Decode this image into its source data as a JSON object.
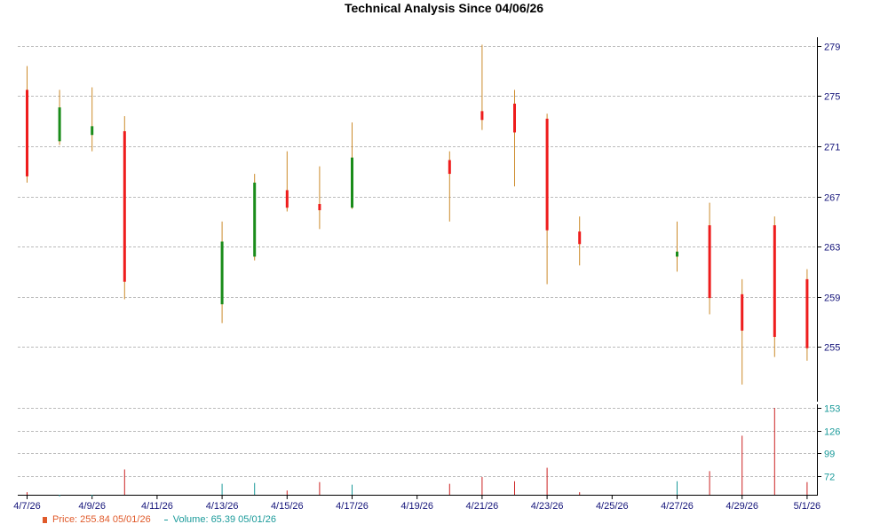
{
  "chart_data": {
    "type": "candlestick",
    "title": "Technical Analysis Since 04/06/26",
    "price_axis": {
      "ticks": [
        279,
        275,
        271,
        267,
        263,
        259,
        255
      ],
      "range": [
        251.2,
        279.2
      ]
    },
    "volume_axis": {
      "ticks": [
        153,
        126,
        99,
        72
      ],
      "range": [
        50,
        153
      ]
    },
    "x_tick_labels": [
      "4/7/26",
      "4/9/26",
      "4/11/26",
      "4/13/26",
      "4/15/26",
      "4/17/26",
      "4/19/26",
      "4/21/26",
      "4/23/26",
      "4/25/26",
      "4/27/26",
      "4/29/26",
      "5/1/26"
    ],
    "candles": [
      {
        "date": "4/7/26",
        "open": 275.5,
        "high": 277.4,
        "low": 268.1,
        "close": 268.6,
        "volume": 53
      },
      {
        "date": "4/8/26",
        "open": 271.4,
        "high": 275.5,
        "low": 271.1,
        "close": 274.1,
        "volume": 48
      },
      {
        "date": "4/9/26",
        "open": 271.9,
        "high": 275.7,
        "low": 270.6,
        "close": 272.6,
        "volume": 48
      },
      {
        "date": "4/10/26",
        "open": 272.2,
        "high": 273.4,
        "low": 258.8,
        "close": 260.2,
        "volume": 80
      },
      {
        "date": "4/13/26",
        "open": 258.4,
        "high": 265.0,
        "low": 256.9,
        "close": 263.4,
        "volume": 63
      },
      {
        "date": "4/14/26",
        "open": 262.2,
        "high": 268.8,
        "low": 261.9,
        "close": 268.1,
        "volume": 64
      },
      {
        "date": "4/15/26",
        "open": 267.5,
        "high": 270.6,
        "low": 265.8,
        "close": 266.1,
        "volume": 55
      },
      {
        "date": "4/16/26",
        "open": 266.4,
        "high": 269.4,
        "low": 264.4,
        "close": 265.9,
        "volume": 65
      },
      {
        "date": "4/17/26",
        "open": 266.1,
        "high": 272.9,
        "low": 266.0,
        "close": 270.1,
        "volume": 62
      },
      {
        "date": "4/20/26",
        "open": 269.9,
        "high": 270.6,
        "low": 265.0,
        "close": 268.8,
        "volume": 63
      },
      {
        "date": "4/21/26",
        "open": 273.8,
        "high": 279.1,
        "low": 272.3,
        "close": 273.1,
        "volume": 71
      },
      {
        "date": "4/22/26",
        "open": 274.4,
        "high": 275.5,
        "low": 267.8,
        "close": 272.1,
        "volume": 66
      },
      {
        "date": "4/23/26",
        "open": 273.2,
        "high": 273.6,
        "low": 260.0,
        "close": 264.3,
        "volume": 82
      },
      {
        "date": "4/24/26",
        "open": 264.2,
        "high": 265.4,
        "low": 261.5,
        "close": 263.2,
        "volume": 53
      },
      {
        "date": "4/27/26",
        "open": 262.2,
        "high": 265.0,
        "low": 261.0,
        "close": 262.6,
        "volume": 66
      },
      {
        "date": "4/28/26",
        "open": 264.7,
        "high": 266.5,
        "low": 257.6,
        "close": 258.9,
        "volume": 78
      },
      {
        "date": "4/29/26",
        "open": 259.2,
        "high": 260.4,
        "low": 252.0,
        "close": 256.3,
        "volume": 120
      },
      {
        "date": "4/30/26",
        "open": 264.7,
        "high": 265.4,
        "low": 254.2,
        "close": 255.8,
        "volume": 153
      },
      {
        "date": "5/1/26",
        "open": 260.4,
        "high": 261.2,
        "low": 253.9,
        "close": 254.9,
        "volume": 65
      }
    ],
    "colors": {
      "up": "#1a8c1a",
      "down": "#ee1c1c",
      "wick": "#cc8a2a",
      "vol_up": "#1a9a9a",
      "vol_down": "#cc2222",
      "axis_text": "#14147a",
      "vol_text": "#1a9a9a"
    }
  },
  "legend": {
    "price": "Price: 255.84  05/01/26",
    "volume": "Volume: 65.39  05/01/26"
  }
}
